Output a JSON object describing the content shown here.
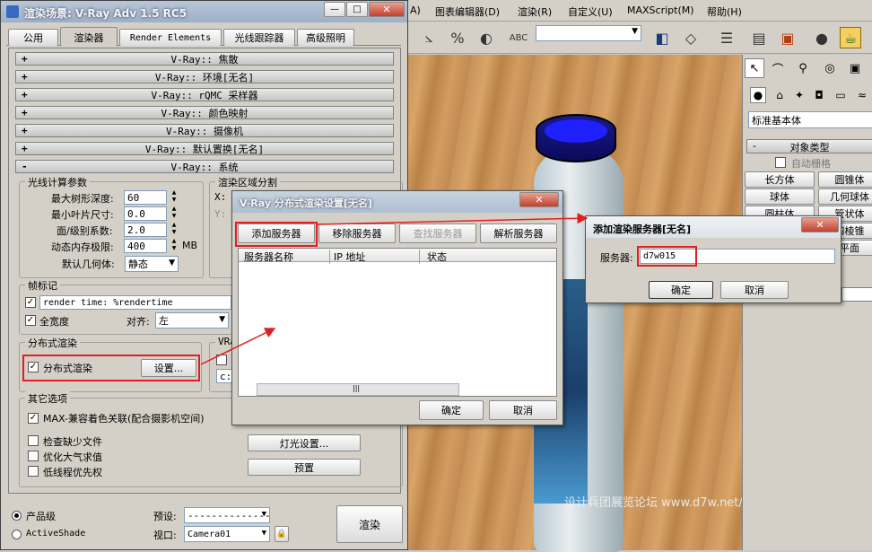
{
  "main_menu": [
    "A)",
    "图表编辑器(D)",
    "渲染(R)",
    "自定义(U)",
    "MAXScript(M)",
    "帮助(H)"
  ],
  "render_window": {
    "title": "渲染场景: V-Ray Adv 1.5 RC5",
    "tabs": [
      "公用",
      "渲染器",
      "Render Elements",
      "光线跟踪器",
      "高级照明"
    ],
    "rollouts": [
      "V-Ray:: 焦散",
      "V-Ray:: 环境[无名]",
      "V-Ray:: rQMC 采样器",
      "V-Ray:: 颜色映射",
      "V-Ray:: 摄像机",
      "V-Ray:: 默认置换[无名]",
      "V-Ray:: 系统"
    ],
    "raycast": {
      "title": "光线计算参数",
      "max_depth_label": "最大树形深度:",
      "max_depth": "60",
      "min_leaf_label": "最小叶片尺寸:",
      "min_leaf": "0.0",
      "face_level_label": "面/级别系数:",
      "face_level": "2.0",
      "mem_label": "动态内存极限:",
      "mem": "400",
      "mem_unit": "MB",
      "geom_label": "默认几何体:",
      "geom": "静态"
    },
    "region": {
      "title": "渲染区域分割",
      "x": "X:",
      "y": "Y:"
    },
    "stamp": {
      "title": "帧标记",
      "text": "render time: %rendertime",
      "full_width": "全宽度",
      "align_label": "对齐:",
      "align": "左"
    },
    "distributed": {
      "title": "分布式渲染",
      "checkbox": "分布式渲染",
      "settings": "设置..."
    },
    "vray_log": {
      "title": "VRa",
      "path": "c:\\"
    },
    "misc": {
      "title": "其它选项",
      "max_compat": "MAX-兼容着色关联(配合摄影机空间)",
      "check_missing": "检查缺少文件",
      "optimize_atm": "优化大气求值",
      "low_thread": "低线程优先权",
      "light_settings": "灯光设置...",
      "presets_btn": "预置"
    },
    "bottom": {
      "production": "产品级",
      "activeshade": "ActiveShade",
      "preset_label": "预设:",
      "preset": "--------------",
      "viewport_label": "视口:",
      "viewport": "Camera01",
      "render": "渲染"
    }
  },
  "dist_dialog": {
    "title": "V-Ray 分布式渲染设置[无名]",
    "buttons": [
      "添加服务器",
      "移除服务器",
      "查找服务器",
      "解析服务器"
    ],
    "columns": [
      "服务器名称",
      "IP 地址",
      "状态"
    ],
    "ok": "确定",
    "cancel": "取消"
  },
  "add_dialog": {
    "title": "添加渲染服务器[无名]",
    "label": "服务器:",
    "value": "d7w015",
    "ok": "确定",
    "cancel": "取消"
  },
  "cmd_panel": {
    "dropdown": "标准基本体",
    "section": "对象类型",
    "autogrid": "自动栅格",
    "objects": [
      "长方体",
      "圆锥体",
      "球体",
      "几何球体",
      "圆柱体",
      "管状体",
      "四棱锥",
      "平面"
    ]
  },
  "watermark": "设计兵团展览论坛 www.d7w.net/forum"
}
